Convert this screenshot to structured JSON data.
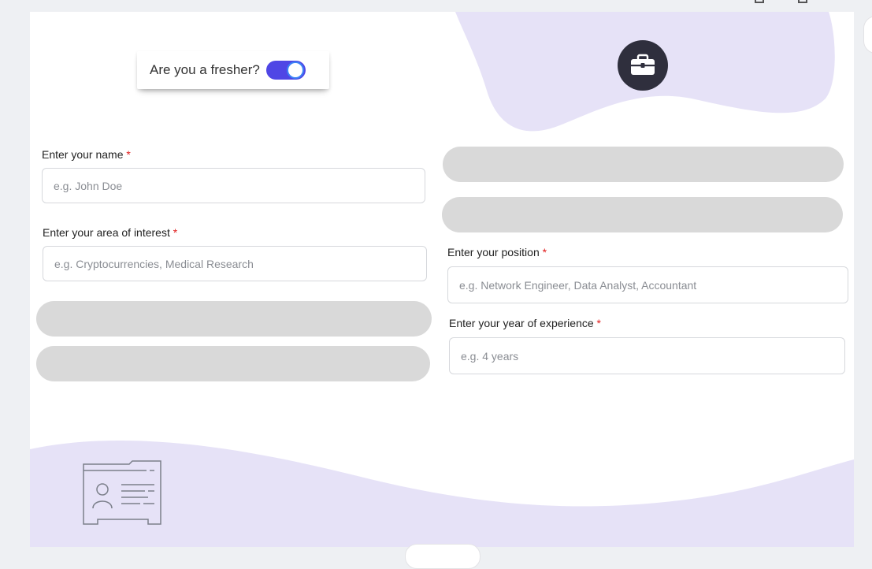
{
  "toggle": {
    "label": "Are you a fresher?",
    "checked": true,
    "color": "#4f46e5"
  },
  "form": {
    "name": {
      "label": "Enter your name",
      "required_mark": "*",
      "placeholder": "e.g. John Doe"
    },
    "interest": {
      "label": "Enter your area of interest",
      "required_mark": "*",
      "placeholder": "e.g. Cryptocurrencies, Medical Research"
    },
    "position": {
      "label": "Enter your position",
      "required_mark": "*",
      "placeholder": "e.g. Network Engineer, Data Analyst, Accountant"
    },
    "experience": {
      "label": "Enter your year of experience",
      "required_mark": "*",
      "placeholder": "e.g. 4 years"
    }
  },
  "icons": {
    "briefcase": "briefcase-icon",
    "id_card": "id-card-icon"
  },
  "colors": {
    "accent": "#4f46e5",
    "blob": "#e6e2f7",
    "required": "#e11d1d",
    "placeholder_pill": "#d9d9d9",
    "icon_circle": "#2f2f3d"
  }
}
